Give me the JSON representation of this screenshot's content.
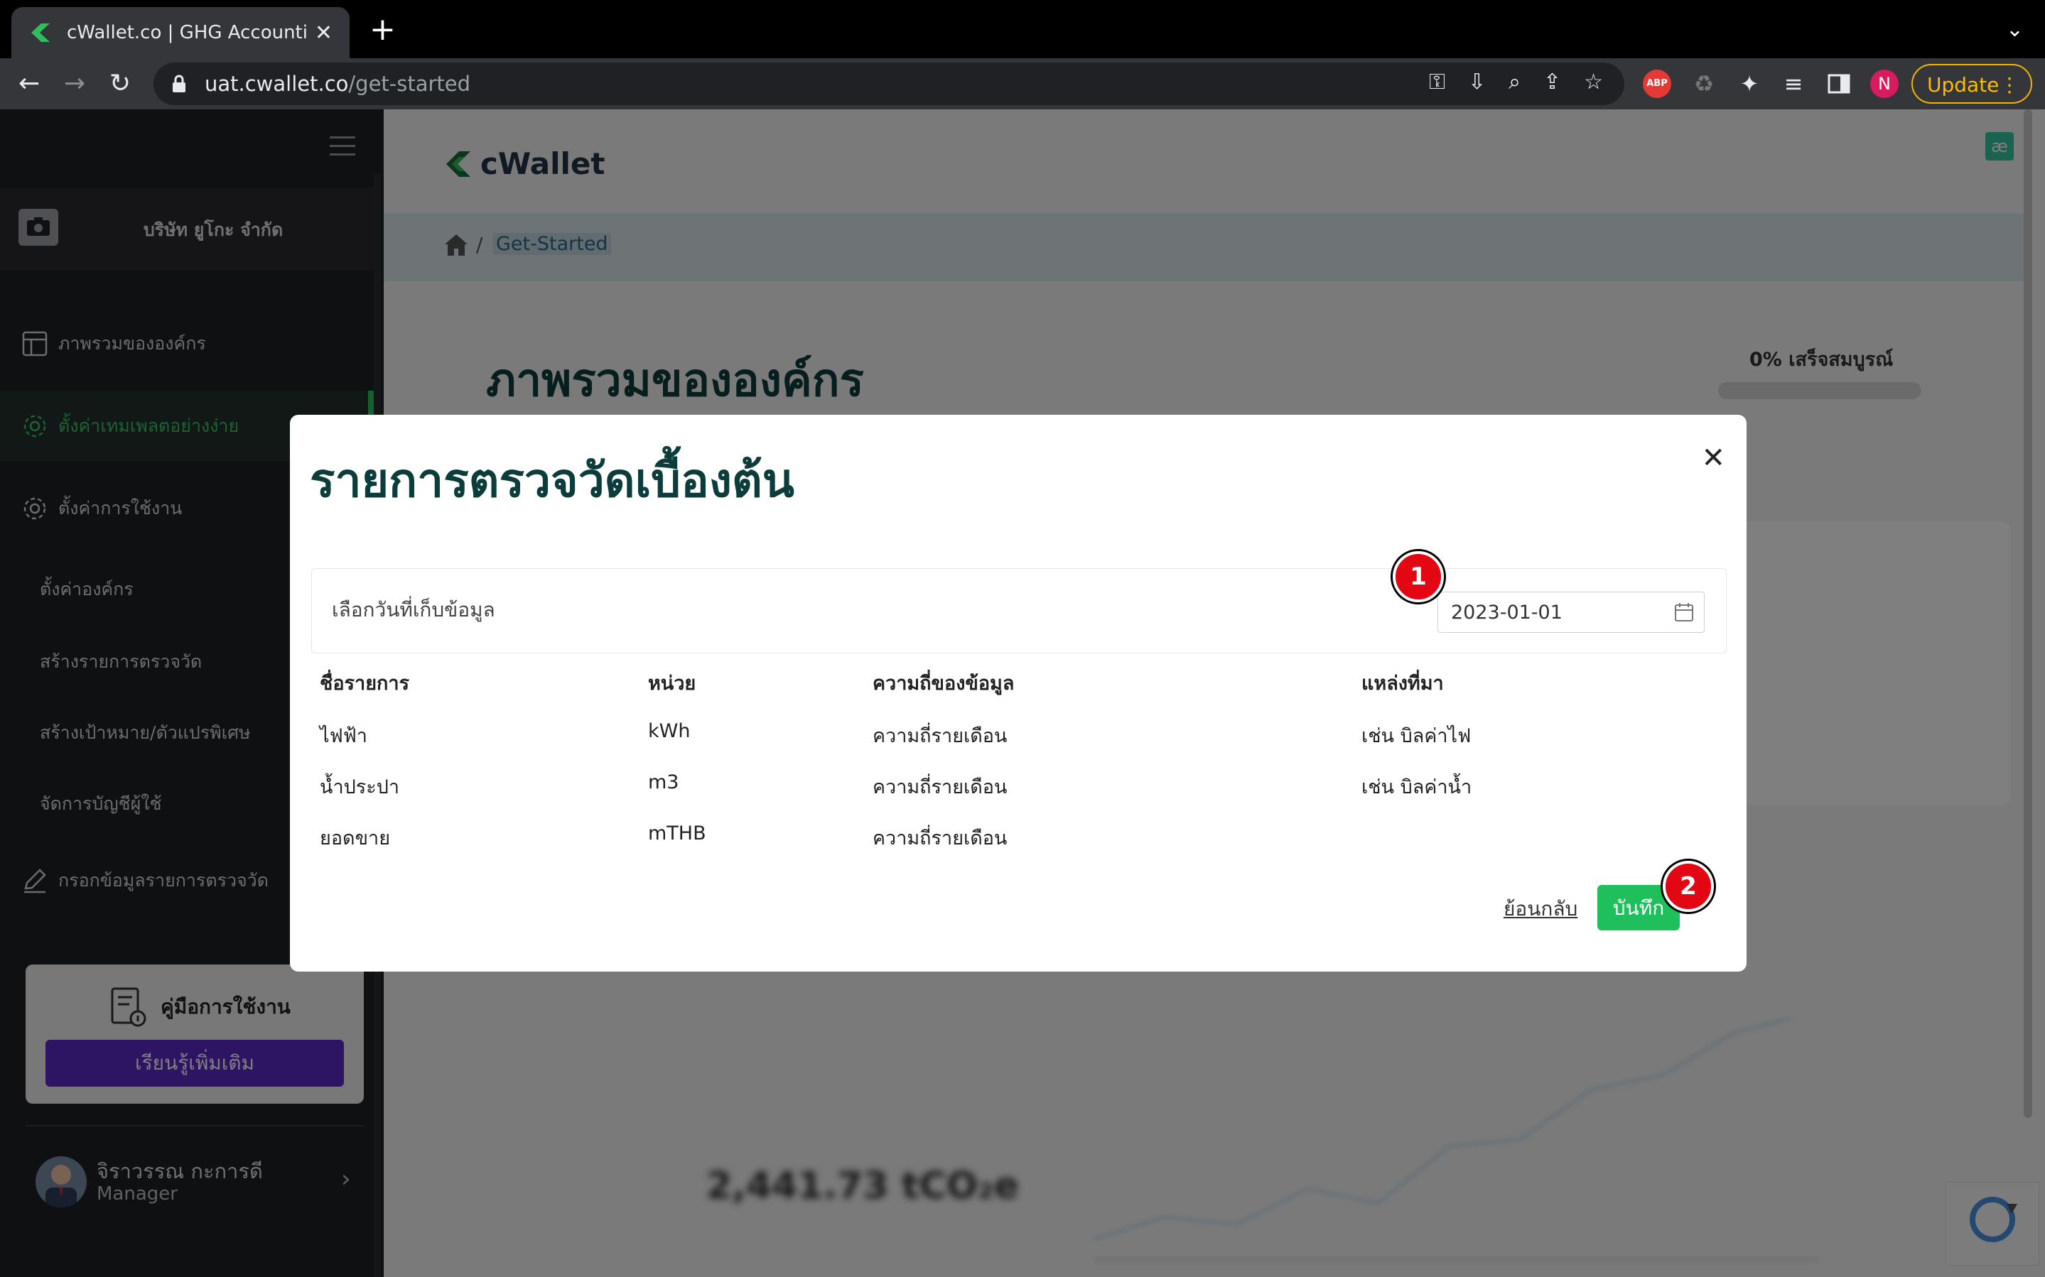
{
  "browser": {
    "tab_title": "cWallet.co | GHG Accounting S",
    "tab_close": "✕",
    "new_tab": "+",
    "url_host": "uat.cwallet.co",
    "url_path": "/get-started",
    "profile_initial": "N",
    "update_label": "Update",
    "extension_abp": "ABP"
  },
  "sidebar": {
    "org_name": "บริษัท ยูโกะ จำกัด",
    "items": [
      {
        "label": "ภาพรวมขององค์กร"
      },
      {
        "label": "ตั้งค่าเทมเพลตอย่างง่าย"
      },
      {
        "label": "ตั้งค่าการใช้งาน"
      },
      {
        "label": "ตั้งค่าองค์กร"
      },
      {
        "label": "สร้างรายการตรวจวัด"
      },
      {
        "label": "สร้างเป้าหมาย/ตัวแปรพิเศษ"
      },
      {
        "label": "จัดการบัญชีผู้ใช้"
      },
      {
        "label": "กรอกข้อมูลรายการตรวจวัด"
      }
    ],
    "guide": {
      "title": "คู่มือการใช้งาน",
      "button": "เรียนรู้เพิ่มเติม"
    },
    "user": {
      "name": "จิราวรรณ กะการดี",
      "role": "Manager"
    }
  },
  "header": {
    "logo_text": "cWallet",
    "breadcrumb_current": "Get-Started"
  },
  "main": {
    "heading": "ภาพรวมขององค์กร",
    "progress_label": "0% เสร็จสมบูรณ์",
    "total_emission": "2,441.73 tCO₂e"
  },
  "modal": {
    "title": "รายการตรวจวัดเบื้องต้น",
    "date_label": "เลือกวันที่เก็บข้อมูล",
    "date_value": "2023-01-01",
    "columns": [
      "ชื่อรายการ",
      "หน่วย",
      "ความถี่ของข้อมูล",
      "แหล่งที่มา"
    ],
    "rows": [
      [
        "ไฟฟ้า",
        "kWh",
        "ความถี่รายเดือน",
        "เช่น บิลค่าไฟ"
      ],
      [
        "น้ำประปา",
        "m3",
        "ความถี่รายเดือน",
        "เช่น บิลค่าน้ำ"
      ],
      [
        "ยอดขาย",
        "mTHB",
        "ความถี่รายเดือน",
        ""
      ]
    ],
    "back_label": "ย้อนกลับ",
    "save_label": "บันทึก"
  },
  "annotations": {
    "marker1": "1",
    "marker2": "2"
  },
  "colors": {
    "brand_green": "#1fbf5c",
    "heading_teal": "#0c3d3a",
    "guide_purple": "#5a2bc9",
    "marker_red": "#e30613"
  }
}
